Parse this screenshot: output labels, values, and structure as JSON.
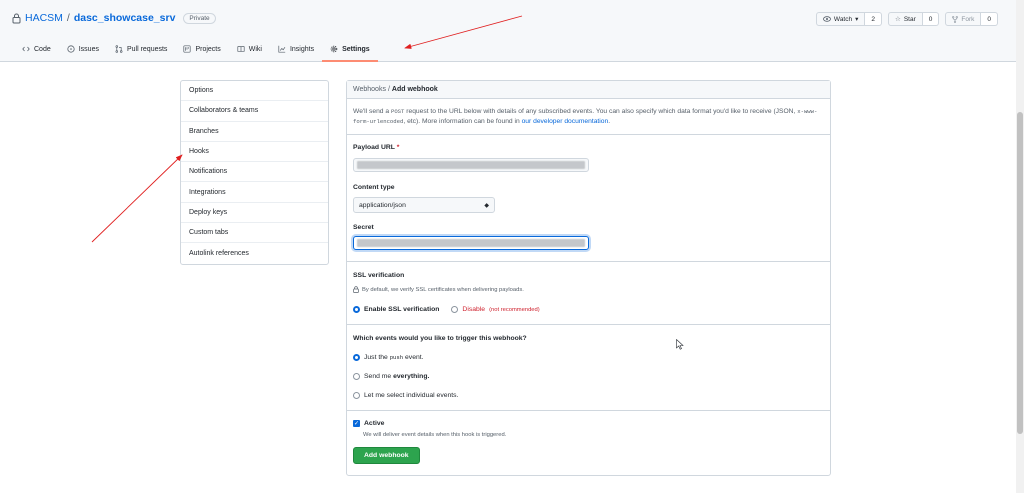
{
  "repo": {
    "owner": "HACSM",
    "separator": "/",
    "name": "dasc_showcase_srv",
    "visibility": "Private"
  },
  "actions": [
    {
      "label": "Watch",
      "count": "2",
      "icon": "eye-icon"
    },
    {
      "label": "Star",
      "count": "0",
      "icon": "star-icon"
    },
    {
      "label": "Fork",
      "count": "0",
      "icon": "fork-icon"
    }
  ],
  "tabs": [
    {
      "label": "Code",
      "icon": "code-icon"
    },
    {
      "label": "Issues",
      "icon": "issue-icon"
    },
    {
      "label": "Pull requests",
      "icon": "pull-request-icon"
    },
    {
      "label": "Projects",
      "icon": "project-icon"
    },
    {
      "label": "Wiki",
      "icon": "book-icon"
    },
    {
      "label": "Insights",
      "icon": "graph-icon"
    },
    {
      "label": "Settings",
      "icon": "gear-icon",
      "active": true
    }
  ],
  "sidebar": {
    "items": [
      {
        "label": "Options"
      },
      {
        "label": "Collaborators & teams"
      },
      {
        "label": "Branches"
      },
      {
        "label": "Hooks"
      },
      {
        "label": "Notifications"
      },
      {
        "label": "Integrations"
      },
      {
        "label": "Deploy keys"
      },
      {
        "label": "Custom tabs"
      },
      {
        "label": "Autolink references"
      }
    ]
  },
  "webhook": {
    "breadcrumb": "Webhooks",
    "breadcrumb_sep": "/",
    "title": "Add webhook",
    "intro_1": "We'll send a",
    "intro_code_1": "POST",
    "intro_2": "request to the URL below with details of any subscribed events. You can also specify which data format you'd like to receive (JSON,",
    "intro_code_2": "x-www-form-urlencoded",
    "intro_3": ", etc). More information can be found in",
    "intro_link": "our developer documentation",
    "intro_end": ".",
    "payload_label": "Payload URL",
    "required_mark": "*",
    "content_type_label": "Content type",
    "content_type_value": "application/json",
    "secret_label": "Secret",
    "ssl_label": "SSL verification",
    "ssl_note": "By default, we verify SSL certificates when delivering payloads.",
    "ssl_enable": "Enable SSL verification",
    "ssl_disable": "Disable",
    "ssl_disable_note": "(not recommended)",
    "events_question": "Which events would you like to trigger this webhook?",
    "event_push_1": "Just the",
    "event_push_code": "push",
    "event_push_2": "event.",
    "event_all_1": "Send me",
    "event_all_bold": "everything.",
    "event_select": "Let me select individual events.",
    "active_label": "Active",
    "active_note": "We will deliver event details when this hook is triggered.",
    "submit_label": "Add webhook"
  },
  "colors": {
    "accent": "#0969da",
    "submit": "#2da44e",
    "annotation_arrow": "#e02020",
    "tab_underline": "#fd8c73"
  }
}
